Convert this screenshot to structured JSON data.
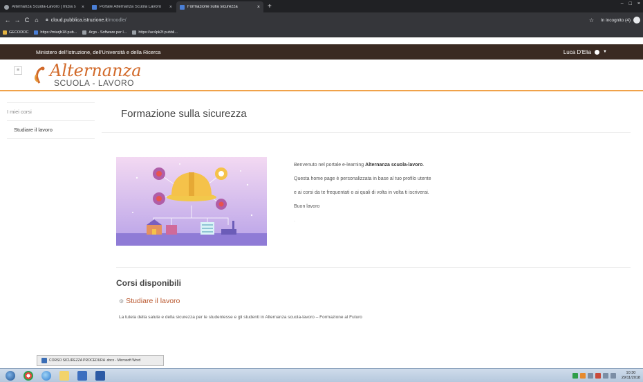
{
  "browser": {
    "tabs": [
      {
        "title": "Alternanza Scuola-Lavoro | Inizia s",
        "active": false
      },
      {
        "title": "Portale Alternanza Scuola Lavoro",
        "active": false
      },
      {
        "title": "Formazione sulla sicurezza",
        "active": true
      }
    ],
    "new_tab_label": "+",
    "window_controls": [
      "–",
      "□",
      "×"
    ],
    "url": {
      "host": "cloud.pubblica.istruzione.it",
      "path": "/moodle/"
    },
    "incognito_label": "In incognito (4)",
    "bookmarks": [
      {
        "label": "GECODOC",
        "icon": "bookmark-icon-yellow"
      },
      {
        "label": "https://miurjb18.pub...",
        "icon": "bookmark-icon-blue"
      },
      {
        "label": "Argo - Software per l...",
        "icon": "globe-icon"
      },
      {
        "label": "https://ac4pk2f.pubbli...",
        "icon": "globe-icon"
      }
    ]
  },
  "ministry_bar": {
    "title": "Ministero dell'Istruzione, dell'Università e della Ricerca",
    "user_name": "Luca D'Elia"
  },
  "logo": {
    "main": "Alternanza",
    "sub": "SCUOLA - LAVORO",
    "menu_icon": "hamburger-icon"
  },
  "sidebar": {
    "items": [
      {
        "label": "I miei corsi"
      },
      {
        "label": "Studiare il lavoro"
      }
    ]
  },
  "main": {
    "page_title": "Formazione sulla sicurezza",
    "welcome": {
      "line1_prefix": "Benvenuto nel portale e-learning ",
      "line1_bold": "Alternanza scuola-lavoro",
      "line1_suffix": ".",
      "line2": "Questa home page è personalizzata in base al tuo profilo utente",
      "line3": "e ai corsi da te frequentati o ai quali di volta in volta ti iscriverai.",
      "line4": "Buon lavoro",
      "line5": "."
    },
    "courses_section": {
      "title": "Corsi disponibili",
      "course_title": "Studiare il lavoro",
      "course_description": "La tutela della salute e della sicurezza per le studentesse e gli studenti in Alternanza scuola-lavoro – Formazione al Futuro"
    }
  },
  "taskbar": {
    "popup_label": "CORSO SICUREZZA PROCEDURA .docx - Microsoft Word",
    "clock_time": "10:30",
    "clock_date": "29/11/2018"
  },
  "colors": {
    "accent": "#d26a2a",
    "ministry_bar": "#3a2a22",
    "header_rule": "#f0a24a",
    "link": "#b8552b"
  }
}
